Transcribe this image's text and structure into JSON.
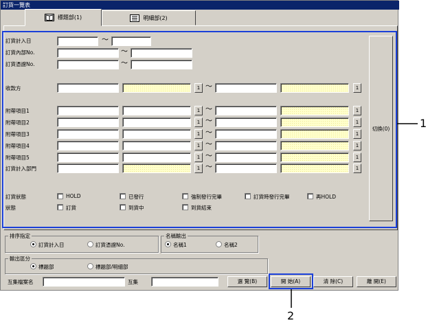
{
  "window": {
    "title": "訂貨一覽表"
  },
  "tabs": [
    {
      "label": "標題部(1)",
      "icon": "book-icon",
      "active": true
    },
    {
      "label": "明細部(2)",
      "icon": "list-icon",
      "active": false
    }
  ],
  "conditions": {
    "order_date_label": "訂貨計入日",
    "internal_no_label": "訂貨內部No.",
    "voucher_no_label": "訂貨憑證No.",
    "collector_label": "收款方",
    "attr1_label": "附帶項目1",
    "attr2_label": "附帶項目2",
    "attr3_label": "附帶項目3",
    "attr4_label": "附帶項目4",
    "attr5_label": "附帶項目5",
    "dept_label": "訂貨計入部門",
    "tilde": "～",
    "lookup_btn": "1"
  },
  "status": {
    "order_status_label": "訂貨狀態",
    "order_status_options": [
      "HOLD",
      "已發行",
      "強制發行完畢",
      "訂貨時發行完畢",
      "再HOLD"
    ],
    "state_label": "狀態",
    "state_options": [
      "訂貨",
      "到貨中",
      "到貨結束"
    ]
  },
  "switch_button": "切換(0)",
  "sort": {
    "title": "排序指定",
    "options": [
      "訂貨計入日",
      "訂貨憑證No."
    ],
    "selected": 0
  },
  "name_output": {
    "title": "名稱輸出",
    "options": [
      "名稱1",
      "名稱2"
    ],
    "selected": 0
  },
  "output_type": {
    "title": "輸出區分",
    "options": [
      "標題部",
      "標題部/明細部"
    ],
    "selected": 0
  },
  "footer": {
    "file_name_label": "互集檔案名",
    "collection_label": "互集",
    "browse_btn": "選 覽(B)",
    "start_btn": "開 始(A)",
    "clear_btn": "清 除(C)",
    "close_btn": "離 開(E)"
  },
  "callouts": {
    "one": "1",
    "two": "2"
  },
  "colors": {
    "highlight": "#1a3fd8",
    "titlebar": "#0a246a",
    "window_bg": "#d4d0c8",
    "required_field": "#ffffcc"
  }
}
